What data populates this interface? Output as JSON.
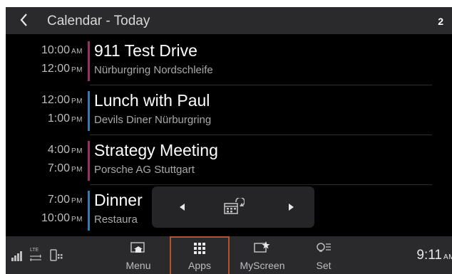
{
  "header": {
    "title": "Calendar - Today",
    "page_badge": "2"
  },
  "events": [
    {
      "start_time": "10:00",
      "start_ampm": "AM",
      "end_time": "12:00",
      "end_ampm": "PM",
      "title": "911 Test Drive",
      "location": "Nürburgring Nordschleife",
      "color": "#9a2f6a"
    },
    {
      "start_time": "12:00",
      "start_ampm": "PM",
      "end_time": "1:00",
      "end_ampm": "PM",
      "title": "Lunch with Paul",
      "location": "Devils Diner Nürburgring",
      "color": "#2f7fae"
    },
    {
      "start_time": "4:00",
      "start_ampm": "PM",
      "end_time": "7:00",
      "end_ampm": "PM",
      "title": "Strategy Meeting",
      "location": "Porsche AG Stuttgart",
      "color": "#9a2f6a"
    },
    {
      "start_time": "7:00",
      "start_ampm": "PM",
      "end_time": "10:00",
      "end_ampm": "PM",
      "title": "Dinner",
      "location": "Restaura",
      "color": "#2f7fae"
    }
  ],
  "popup": {
    "prev_icon": "triangle-left",
    "center_icon": "calendar-sync-icon",
    "next_icon": "triangle-right"
  },
  "status": {
    "network_label": "LTE"
  },
  "nav": [
    {
      "label": "Menu",
      "icon": "home-window-icon",
      "active": false
    },
    {
      "label": "Apps",
      "icon": "grid-icon",
      "active": true
    },
    {
      "label": "MyScreen",
      "icon": "star-window-icon",
      "active": false
    },
    {
      "label": "Set",
      "icon": "settings-icon",
      "active": false
    }
  ],
  "clock": {
    "time": "9:11",
    "ampm": "AM"
  },
  "colors": {
    "accent": "#b6532c",
    "background": "#000000",
    "bar": "#2a2a2c"
  }
}
